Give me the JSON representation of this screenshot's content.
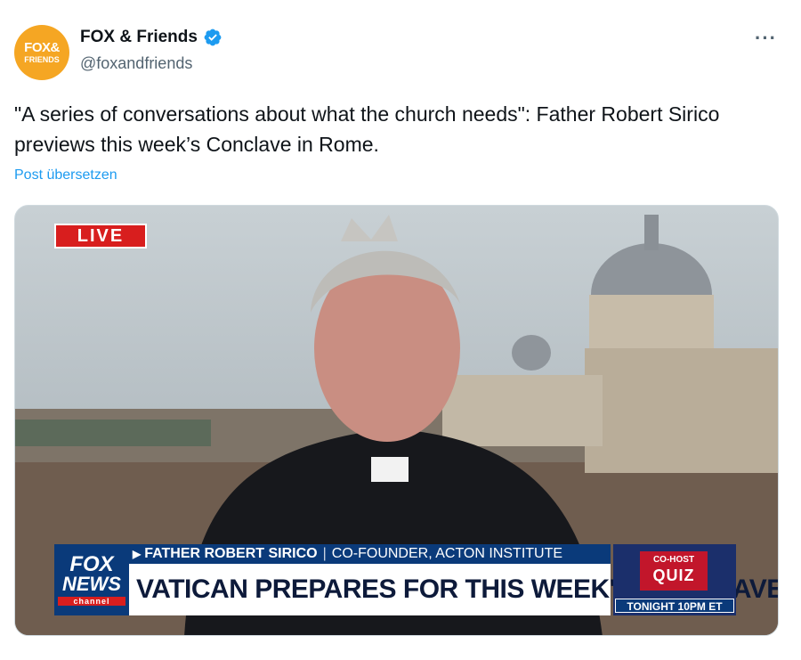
{
  "account": {
    "avatar_line1": "FOX&",
    "avatar_line2": "FRIENDS",
    "display_name": "FOX & Friends",
    "handle": "@foxandfriends",
    "verified": true
  },
  "menu": {
    "more_label": "···"
  },
  "post": {
    "text": "\"A series of conversations about what the church needs\": Father Robert Sirico previews this week’s Conclave in Rome.",
    "translate_label": "Post übersetzen"
  },
  "video": {
    "live_badge": "LIVE",
    "network_logo": {
      "line1": "FOX",
      "line2": "NEWS",
      "line3": "channel"
    },
    "lower_third": {
      "name": "FATHER ROBERT SIRICO",
      "title": "CO-FOUNDER, ACTON INSTITUTE",
      "headline": "VATICAN PREPARES FOR THIS WEEK'S CONCLAVE"
    },
    "promo": {
      "top": "CO-HOST",
      "main": "QUIZ",
      "time": "TONIGHT 10PM ET"
    }
  },
  "colors": {
    "text_primary": "#0f1419",
    "text_secondary": "#536471",
    "link": "#1d9bf0",
    "verified": "#1d9bf0",
    "fox_blue": "#0a3a7a",
    "live_red": "#d81e1e",
    "avatar_orange": "#f5a623"
  },
  "icons": [
    "verified-badge-icon",
    "more-options-icon"
  ]
}
